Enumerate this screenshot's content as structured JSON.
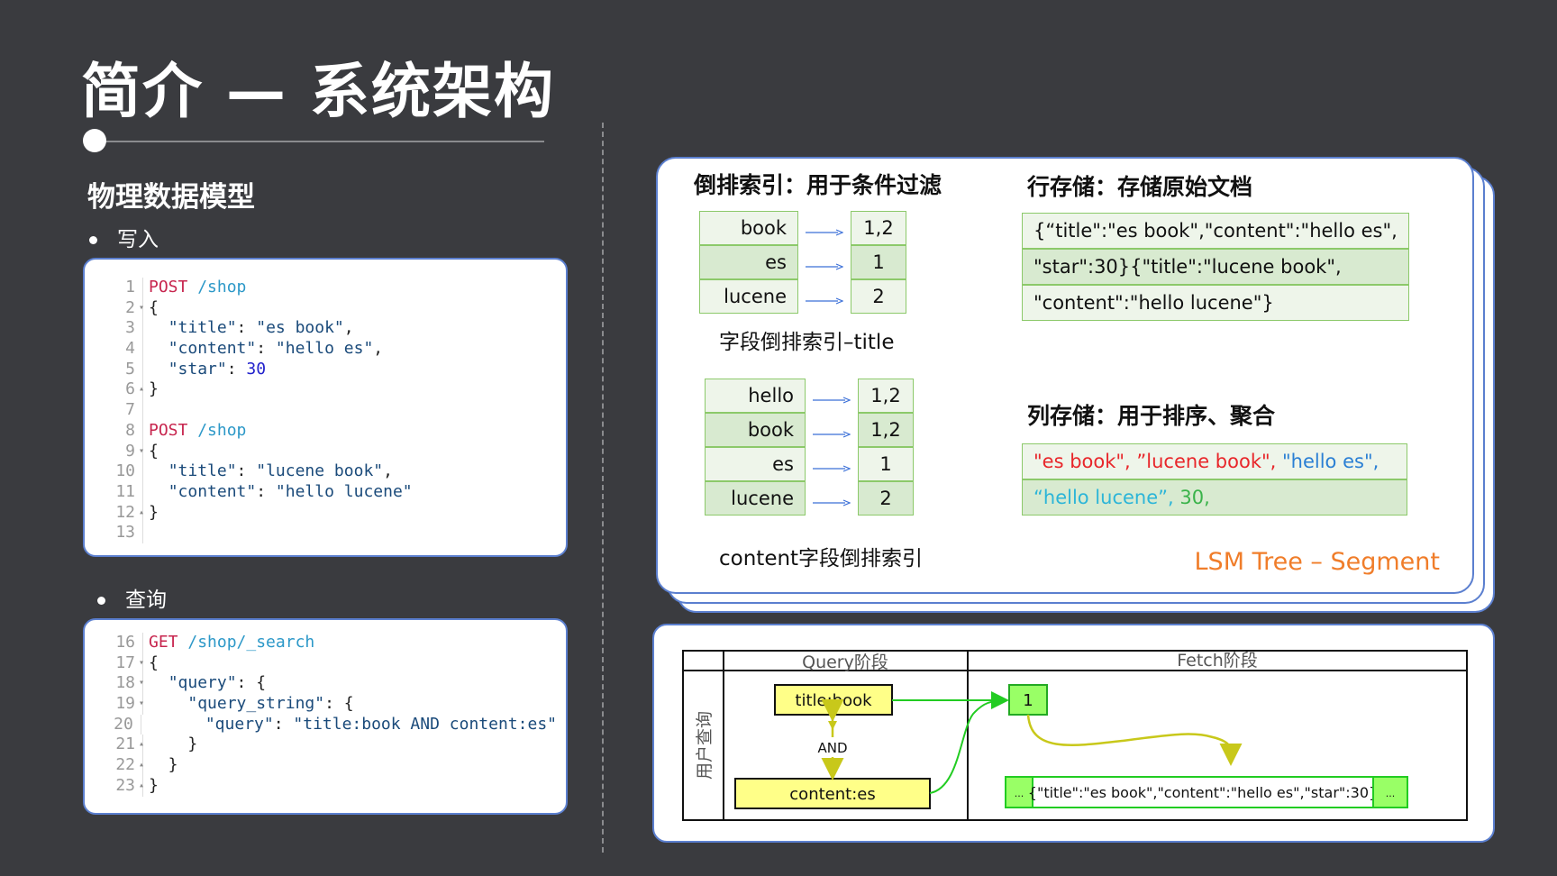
{
  "slide": {
    "title": "简介 — 系统架构",
    "section_heading": "物理数据模型",
    "bullet_write": "写入",
    "bullet_query": "查询"
  },
  "write_code": [
    {
      "n": "1",
      "fold": "",
      "parts": [
        {
          "c": "kw",
          "t": "POST "
        },
        {
          "c": "url",
          "t": "/shop"
        }
      ]
    },
    {
      "n": "2",
      "fold": "▾",
      "parts": [
        {
          "c": "punc",
          "t": "{"
        }
      ]
    },
    {
      "n": "3",
      "fold": "",
      "parts": [
        {
          "c": "punc",
          "t": "  "
        },
        {
          "c": "str",
          "t": "\"title\""
        },
        {
          "c": "punc",
          "t": ": "
        },
        {
          "c": "str",
          "t": "\"es book\""
        },
        {
          "c": "punc",
          "t": ","
        }
      ]
    },
    {
      "n": "4",
      "fold": "",
      "parts": [
        {
          "c": "punc",
          "t": "  "
        },
        {
          "c": "str",
          "t": "\"content\""
        },
        {
          "c": "punc",
          "t": ": "
        },
        {
          "c": "str",
          "t": "\"hello es\""
        },
        {
          "c": "punc",
          "t": ","
        }
      ]
    },
    {
      "n": "5",
      "fold": "",
      "parts": [
        {
          "c": "punc",
          "t": "  "
        },
        {
          "c": "str",
          "t": "\"star\""
        },
        {
          "c": "punc",
          "t": ": "
        },
        {
          "c": "num",
          "t": "30"
        }
      ]
    },
    {
      "n": "6",
      "fold": "▴",
      "parts": [
        {
          "c": "punc",
          "t": "}"
        }
      ]
    },
    {
      "n": "7",
      "fold": "",
      "parts": [
        {
          "c": "punc",
          "t": ""
        }
      ]
    },
    {
      "n": "8",
      "fold": "",
      "parts": [
        {
          "c": "kw",
          "t": "POST "
        },
        {
          "c": "url",
          "t": "/shop"
        }
      ]
    },
    {
      "n": "9",
      "fold": "▾",
      "parts": [
        {
          "c": "punc",
          "t": "{"
        }
      ]
    },
    {
      "n": "10",
      "fold": "",
      "parts": [
        {
          "c": "punc",
          "t": "  "
        },
        {
          "c": "str",
          "t": "\"title\""
        },
        {
          "c": "punc",
          "t": ": "
        },
        {
          "c": "str",
          "t": "\"lucene book\""
        },
        {
          "c": "punc",
          "t": ","
        }
      ]
    },
    {
      "n": "11",
      "fold": "",
      "parts": [
        {
          "c": "punc",
          "t": "  "
        },
        {
          "c": "str",
          "t": "\"content\""
        },
        {
          "c": "punc",
          "t": ": "
        },
        {
          "c": "str",
          "t": "\"hello lucene\""
        }
      ]
    },
    {
      "n": "12",
      "fold": "▴",
      "parts": [
        {
          "c": "punc",
          "t": "}"
        }
      ]
    },
    {
      "n": "13",
      "fold": "",
      "parts": [
        {
          "c": "punc",
          "t": ""
        }
      ]
    }
  ],
  "query_code": [
    {
      "n": "16",
      "fold": "",
      "parts": [
        {
          "c": "kw",
          "t": "GET "
        },
        {
          "c": "url",
          "t": "/shop/_search"
        }
      ]
    },
    {
      "n": "17",
      "fold": "▾",
      "parts": [
        {
          "c": "punc",
          "t": "{"
        }
      ]
    },
    {
      "n": "18",
      "fold": "▾",
      "parts": [
        {
          "c": "punc",
          "t": "  "
        },
        {
          "c": "str",
          "t": "\"query\""
        },
        {
          "c": "punc",
          "t": ": {"
        }
      ]
    },
    {
      "n": "19",
      "fold": "▾",
      "parts": [
        {
          "c": "punc",
          "t": "    "
        },
        {
          "c": "str",
          "t": "\"query_string\""
        },
        {
          "c": "punc",
          "t": ": {"
        }
      ]
    },
    {
      "n": "20",
      "fold": "",
      "parts": [
        {
          "c": "punc",
          "t": "      "
        },
        {
          "c": "str",
          "t": "\"query\""
        },
        {
          "c": "punc",
          "t": ": "
        },
        {
          "c": "str",
          "t": "\"title:book AND content:es\""
        }
      ]
    },
    {
      "n": "21",
      "fold": "▴",
      "parts": [
        {
          "c": "punc",
          "t": "    }"
        }
      ]
    },
    {
      "n": "22",
      "fold": "▴",
      "parts": [
        {
          "c": "punc",
          "t": "  }"
        }
      ]
    },
    {
      "n": "23",
      "fold": "▴",
      "parts": [
        {
          "c": "punc",
          "t": "}"
        }
      ]
    }
  ],
  "segment": {
    "inverted_header": "倒排索引：用于条件过滤",
    "row_store_header": "行存储：存储原始文档",
    "column_store_header": "列存储：用于排序、聚合",
    "title_index_caption": "字段倒排索引–title",
    "content_index_caption": "content字段倒排索引",
    "footer": "LSM Tree – Segment",
    "title_index": [
      {
        "term": "book",
        "postings": "1,2"
      },
      {
        "term": "es",
        "postings": "1"
      },
      {
        "term": "lucene",
        "postings": "2"
      }
    ],
    "content_index": [
      {
        "term": "hello",
        "postings": "1,2"
      },
      {
        "term": "book",
        "postings": "1,2"
      },
      {
        "term": "es",
        "postings": "1"
      },
      {
        "term": "lucene",
        "postings": "2"
      }
    ],
    "row_store": [
      "{“title\":\"es book\",\"content\":\"hello es\",",
      "\"star\":30}{\"title\":\"lucene book\",",
      "\"content\":\"hello lucene\"}"
    ],
    "column_store": {
      "line1": [
        {
          "t": "\"es book\", ",
          "color": "#e8262a"
        },
        {
          "t": "”lucene book\", ",
          "color": "#e8262a"
        },
        {
          "t": "\"hello es\",",
          "color": "#2a7fd4"
        }
      ],
      "line2": [
        {
          "t": "“hello lucene”, ",
          "color": "#2cb5d8"
        },
        {
          "t": "30,",
          "color": "#3ab34a"
        }
      ]
    }
  },
  "flow": {
    "query_phase": "Query阶段",
    "fetch_phase": "Fetch阶段",
    "user_query": "用户查询",
    "term_title": "title:book",
    "and_label": "AND",
    "term_content": "content:es",
    "doc_id": "1",
    "ellipsis": "...",
    "fetched_doc": "{\"title\":\"es book\",\"content\":\"hello es\",\"star\":30}"
  },
  "colors": {
    "background": "#3a3b3f",
    "panel_border": "#5b7fcf",
    "cell_border": "#8cc96a",
    "cell_light": "#eef5ea",
    "cell_dark": "#d8ead0",
    "lsm_orange": "#f07d2a",
    "flow_green": "#22cc22",
    "flow_yellow": "#ffff88",
    "arrow_yellow": "#c8c81a"
  }
}
